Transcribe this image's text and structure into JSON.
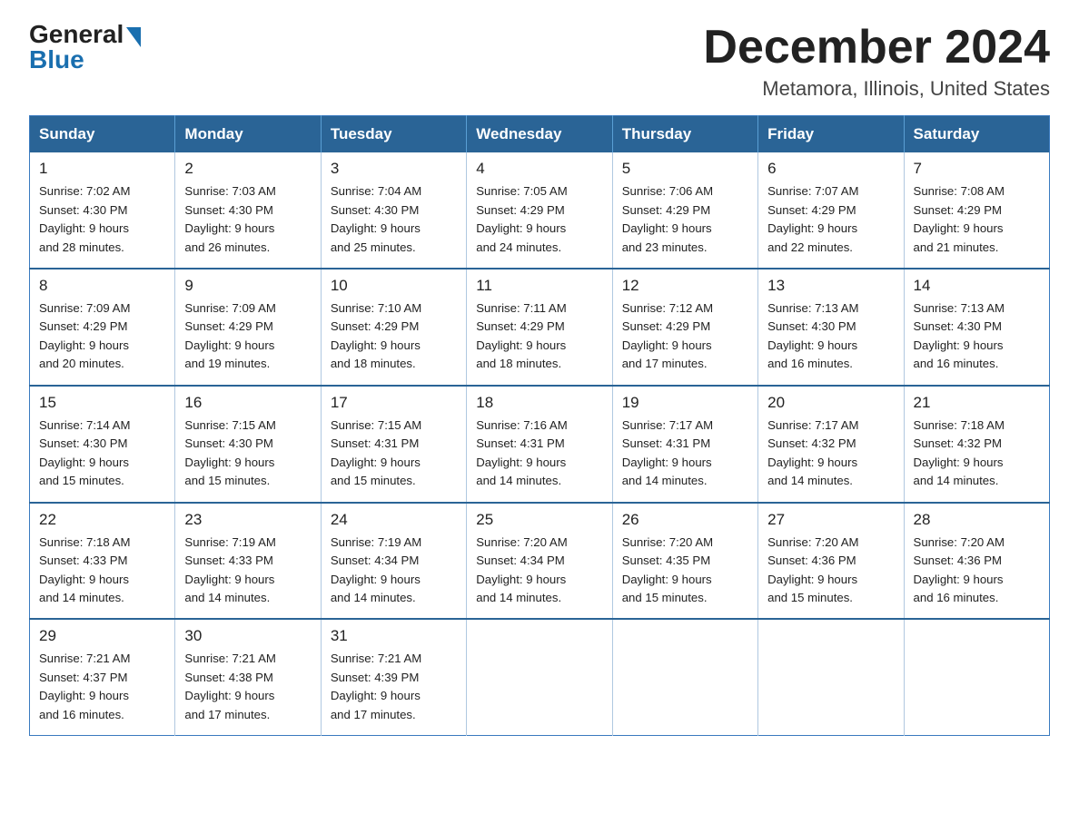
{
  "logo": {
    "general": "General",
    "blue": "Blue"
  },
  "title": "December 2024",
  "location": "Metamora, Illinois, United States",
  "days_of_week": [
    "Sunday",
    "Monday",
    "Tuesday",
    "Wednesday",
    "Thursday",
    "Friday",
    "Saturday"
  ],
  "weeks": [
    [
      {
        "day": "1",
        "sunrise": "7:02 AM",
        "sunset": "4:30 PM",
        "daylight": "9 hours and 28 minutes."
      },
      {
        "day": "2",
        "sunrise": "7:03 AM",
        "sunset": "4:30 PM",
        "daylight": "9 hours and 26 minutes."
      },
      {
        "day": "3",
        "sunrise": "7:04 AM",
        "sunset": "4:30 PM",
        "daylight": "9 hours and 25 minutes."
      },
      {
        "day": "4",
        "sunrise": "7:05 AM",
        "sunset": "4:29 PM",
        "daylight": "9 hours and 24 minutes."
      },
      {
        "day": "5",
        "sunrise": "7:06 AM",
        "sunset": "4:29 PM",
        "daylight": "9 hours and 23 minutes."
      },
      {
        "day": "6",
        "sunrise": "7:07 AM",
        "sunset": "4:29 PM",
        "daylight": "9 hours and 22 minutes."
      },
      {
        "day": "7",
        "sunrise": "7:08 AM",
        "sunset": "4:29 PM",
        "daylight": "9 hours and 21 minutes."
      }
    ],
    [
      {
        "day": "8",
        "sunrise": "7:09 AM",
        "sunset": "4:29 PM",
        "daylight": "9 hours and 20 minutes."
      },
      {
        "day": "9",
        "sunrise": "7:09 AM",
        "sunset": "4:29 PM",
        "daylight": "9 hours and 19 minutes."
      },
      {
        "day": "10",
        "sunrise": "7:10 AM",
        "sunset": "4:29 PM",
        "daylight": "9 hours and 18 minutes."
      },
      {
        "day": "11",
        "sunrise": "7:11 AM",
        "sunset": "4:29 PM",
        "daylight": "9 hours and 18 minutes."
      },
      {
        "day": "12",
        "sunrise": "7:12 AM",
        "sunset": "4:29 PM",
        "daylight": "9 hours and 17 minutes."
      },
      {
        "day": "13",
        "sunrise": "7:13 AM",
        "sunset": "4:30 PM",
        "daylight": "9 hours and 16 minutes."
      },
      {
        "day": "14",
        "sunrise": "7:13 AM",
        "sunset": "4:30 PM",
        "daylight": "9 hours and 16 minutes."
      }
    ],
    [
      {
        "day": "15",
        "sunrise": "7:14 AM",
        "sunset": "4:30 PM",
        "daylight": "9 hours and 15 minutes."
      },
      {
        "day": "16",
        "sunrise": "7:15 AM",
        "sunset": "4:30 PM",
        "daylight": "9 hours and 15 minutes."
      },
      {
        "day": "17",
        "sunrise": "7:15 AM",
        "sunset": "4:31 PM",
        "daylight": "9 hours and 15 minutes."
      },
      {
        "day": "18",
        "sunrise": "7:16 AM",
        "sunset": "4:31 PM",
        "daylight": "9 hours and 14 minutes."
      },
      {
        "day": "19",
        "sunrise": "7:17 AM",
        "sunset": "4:31 PM",
        "daylight": "9 hours and 14 minutes."
      },
      {
        "day": "20",
        "sunrise": "7:17 AM",
        "sunset": "4:32 PM",
        "daylight": "9 hours and 14 minutes."
      },
      {
        "day": "21",
        "sunrise": "7:18 AM",
        "sunset": "4:32 PM",
        "daylight": "9 hours and 14 minutes."
      }
    ],
    [
      {
        "day": "22",
        "sunrise": "7:18 AM",
        "sunset": "4:33 PM",
        "daylight": "9 hours and 14 minutes."
      },
      {
        "day": "23",
        "sunrise": "7:19 AM",
        "sunset": "4:33 PM",
        "daylight": "9 hours and 14 minutes."
      },
      {
        "day": "24",
        "sunrise": "7:19 AM",
        "sunset": "4:34 PM",
        "daylight": "9 hours and 14 minutes."
      },
      {
        "day": "25",
        "sunrise": "7:20 AM",
        "sunset": "4:34 PM",
        "daylight": "9 hours and 14 minutes."
      },
      {
        "day": "26",
        "sunrise": "7:20 AM",
        "sunset": "4:35 PM",
        "daylight": "9 hours and 15 minutes."
      },
      {
        "day": "27",
        "sunrise": "7:20 AM",
        "sunset": "4:36 PM",
        "daylight": "9 hours and 15 minutes."
      },
      {
        "day": "28",
        "sunrise": "7:20 AM",
        "sunset": "4:36 PM",
        "daylight": "9 hours and 16 minutes."
      }
    ],
    [
      {
        "day": "29",
        "sunrise": "7:21 AM",
        "sunset": "4:37 PM",
        "daylight": "9 hours and 16 minutes."
      },
      {
        "day": "30",
        "sunrise": "7:21 AM",
        "sunset": "4:38 PM",
        "daylight": "9 hours and 17 minutes."
      },
      {
        "day": "31",
        "sunrise": "7:21 AM",
        "sunset": "4:39 PM",
        "daylight": "9 hours and 17 minutes."
      },
      null,
      null,
      null,
      null
    ]
  ],
  "labels": {
    "sunrise": "Sunrise:",
    "sunset": "Sunset:",
    "daylight": "Daylight:"
  },
  "colors": {
    "header_bg": "#2a6496",
    "header_text": "#ffffff",
    "border": "#2a6496",
    "cell_border": "#b0c8e0"
  }
}
